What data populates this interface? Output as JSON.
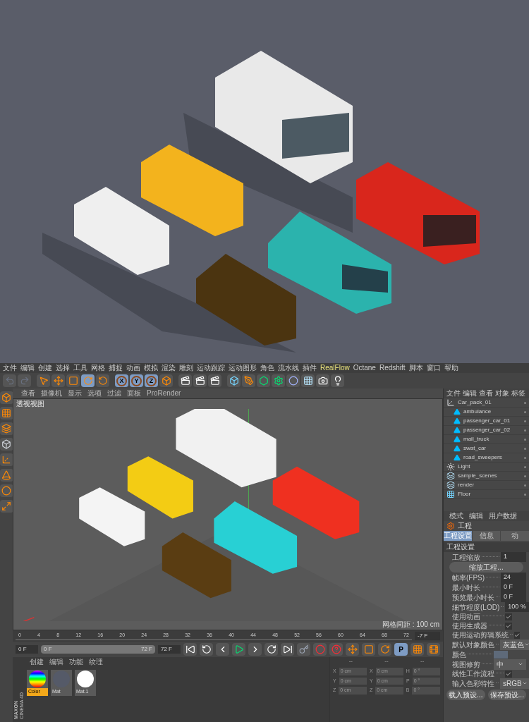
{
  "render_preview": {
    "kind": "picture"
  },
  "menu_bar": [
    {
      "label": "文件",
      "kind": "plain"
    },
    {
      "label": "编辑",
      "kind": "plain"
    },
    {
      "label": "创建",
      "kind": "plain"
    },
    {
      "label": "选择",
      "kind": "plain"
    },
    {
      "label": "工具",
      "kind": "plain"
    },
    {
      "label": "网格",
      "kind": "plain"
    },
    {
      "label": "捕捉",
      "kind": "plain"
    },
    {
      "label": "动画",
      "kind": "plain"
    },
    {
      "label": "模拟",
      "kind": "plain"
    },
    {
      "label": "渲染",
      "kind": "plain"
    },
    {
      "label": "雕刻",
      "kind": "plain"
    },
    {
      "label": "运动跟踪",
      "kind": "plain"
    },
    {
      "label": "运动图形",
      "kind": "plain"
    },
    {
      "label": "角色",
      "kind": "plain"
    },
    {
      "label": "流水线",
      "kind": "plain"
    },
    {
      "label": "插件",
      "kind": "plain"
    },
    {
      "label": "RealFlow",
      "kind": "plugin"
    },
    {
      "label": "Octane",
      "kind": "plain"
    },
    {
      "label": "Redshift",
      "kind": "plain"
    },
    {
      "label": "脚本",
      "kind": "plain"
    },
    {
      "label": "窗口",
      "kind": "plain"
    },
    {
      "label": "帮助",
      "kind": "plain"
    }
  ],
  "axis_locks": [
    {
      "label": "X",
      "on": true
    },
    {
      "label": "Y",
      "on": true
    },
    {
      "label": "Z",
      "on": true
    }
  ],
  "viewport": {
    "menu": [
      "查看",
      "摄像机",
      "显示",
      "选项",
      "过滤",
      "面板",
      "ProRender"
    ],
    "title": "透视视图",
    "grid_spacing": "网格间距 : 100 cm",
    "kind": "picture"
  },
  "object_manager": {
    "menu": [
      "文件",
      "编辑",
      "查看",
      "对象",
      "标签"
    ],
    "objects": [
      {
        "name": "Car_pack_01",
        "kind": "null",
        "children": [
          {
            "name": "ambulance",
            "kind": "polygon"
          },
          {
            "name": "passenger_car_01",
            "kind": "polygon"
          },
          {
            "name": "passenger_car_02",
            "kind": "polygon"
          },
          {
            "name": "mail_truck",
            "kind": "polygon"
          },
          {
            "name": "swat_car",
            "kind": "polygon"
          },
          {
            "name": "road_sweepers",
            "kind": "polygon"
          }
        ]
      },
      {
        "name": "Light",
        "kind": "light"
      },
      {
        "name": "sample_scenes",
        "kind": "group"
      },
      {
        "name": "render",
        "kind": "group"
      },
      {
        "name": "Floor",
        "kind": "floor"
      }
    ]
  },
  "attributes": {
    "menu": [
      "模式",
      "编辑",
      "用户数据"
    ],
    "title": "工程",
    "tabs": [
      {
        "label": "工程设置",
        "selected": true
      },
      {
        "label": "信息",
        "selected": false
      },
      {
        "label": "动",
        "selected": false
      }
    ],
    "section": "工程设置",
    "rows": [
      {
        "kind": "field",
        "label": "工程缩放",
        "value": "1"
      },
      {
        "kind": "button",
        "label": "缩放工程..."
      },
      {
        "kind": "field",
        "label": "帧率(FPS)",
        "value": "24"
      },
      {
        "kind": "field",
        "label": "最小时长",
        "value": "0 F"
      },
      {
        "kind": "field",
        "label": "预览最小时长",
        "value": "0 F"
      },
      {
        "kind": "field",
        "label": "细节程度(LOD)",
        "value": "100 %"
      },
      {
        "kind": "check",
        "label": "使用动画",
        "checked": true
      },
      {
        "kind": "check",
        "label": "使用生成器",
        "checked": true
      },
      {
        "kind": "check",
        "label": "使用运动剪辑系统",
        "checked": true
      },
      {
        "kind": "dropdown",
        "label": "默认对象颜色",
        "value": "灰蓝色"
      },
      {
        "kind": "color",
        "label": "颜色"
      },
      {
        "kind": "dropdown",
        "label": "视图修剪",
        "value": "中"
      },
      {
        "kind": "check",
        "label": "线性工作流程",
        "checked": true
      },
      {
        "kind": "dropdown",
        "label": "输入色彩特性",
        "value": "sRGB"
      }
    ],
    "buttons": [
      "载入预设...",
      "保存预设..."
    ]
  },
  "timeline": {
    "ticks": [
      "0",
      "4",
      "8",
      "12",
      "16",
      "20",
      "24",
      "28",
      "32",
      "36",
      "40",
      "44",
      "48",
      "52",
      "56",
      "60",
      "64",
      "68",
      "72"
    ],
    "current": "-7 F",
    "start": "0 F",
    "range": {
      "start": "0 F",
      "end": "72 F",
      "level": 1
    },
    "end": "72 F",
    "param_button": "P"
  },
  "materials": {
    "menu": [
      "创建",
      "编辑",
      "功能",
      "纹理"
    ],
    "items": [
      {
        "name": "Color",
        "kind": "rainbow",
        "selected": true
      },
      {
        "name": "Mat",
        "kind": "matte",
        "selected": false
      },
      {
        "name": "Mat.1",
        "kind": "white",
        "selected": false
      }
    ]
  },
  "coordinates": {
    "headers": [
      "--",
      "--",
      "--"
    ],
    "rows": [
      {
        "axis": "X",
        "position": "0 cm",
        "size_axis": "X",
        "size": "0 cm",
        "rot_axis": "H",
        "rotation": "0 °"
      },
      {
        "axis": "Y",
        "position": "0 cm",
        "size_axis": "Y",
        "size": "0 cm",
        "rot_axis": "P",
        "rotation": "0 °"
      },
      {
        "axis": "Z",
        "position": "0 cm",
        "size_axis": "Z",
        "size": "0 cm",
        "rot_axis": "B",
        "rotation": "0 °"
      }
    ]
  },
  "logo": [
    "MAXON",
    "CINEMA 4D"
  ]
}
